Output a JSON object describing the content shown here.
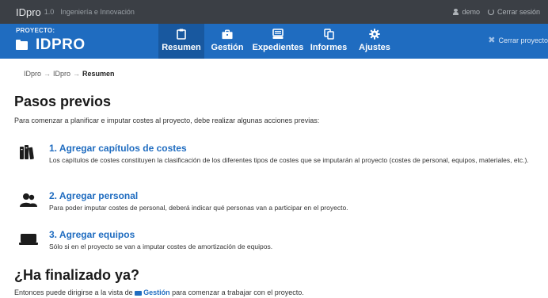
{
  "topbar": {
    "brand": "IDpro",
    "version": "1.0",
    "org": "Ingeniería e Innovación",
    "user": "demo",
    "logout": "Cerrar sesión"
  },
  "project": {
    "label": "PROYECTO:",
    "name": "IDPRO",
    "logout": "Cerrar proyecto"
  },
  "tabs": [
    {
      "label": "Resumen",
      "icon": "clipboard-icon",
      "active": true
    },
    {
      "label": "Gestión",
      "icon": "briefcase-icon"
    },
    {
      "label": "Expedientes",
      "icon": "folder-stack-icon"
    },
    {
      "label": "Informes",
      "icon": "documents-icon"
    },
    {
      "label": "Ajustes",
      "icon": "gear-icon"
    }
  ],
  "breadcrumb": [
    "IDpro",
    "IDpro",
    "Resumen"
  ],
  "main": {
    "title": "Pasos previos",
    "intro": "Para comenzar a planificar e imputar costes al proyecto, debe realizar algunas acciones previas:",
    "steps": [
      {
        "title": "1. Agregar capítulos de costes",
        "desc": "Los capítulos de costes constituyen la clasificación de los diferentes tipos de costes que se imputarán al proyecto (costes de personal, equipos, materiales, etc.).",
        "icon": "binders-icon"
      },
      {
        "title": "2. Agregar personal",
        "desc": "Para poder imputar costes de personal, deberá indicar qué personas van a participar en el proyecto.",
        "icon": "users-icon"
      },
      {
        "title": "3. Agregar equipos",
        "desc": "Sólo si en el proyecto se van a imputar costes de amortización de equipos.",
        "icon": "laptop-icon"
      }
    ],
    "finished_title": "¿Ha finalizado ya?",
    "finished_pre": "Entonces puede dirigirse a la vista de",
    "finished_link": "Gestión",
    "finished_post": "para comenzar a trabajar con el proyecto."
  },
  "colors": {
    "accent": "#1f6cc0",
    "topbar": "#3b3f45"
  }
}
